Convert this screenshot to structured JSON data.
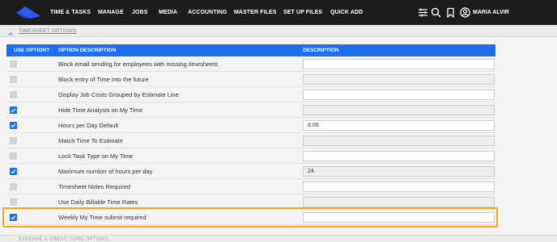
{
  "nav": {
    "items": [
      "TIME & TASKS",
      "MANAGE",
      "JOBS",
      "MEDIA",
      "ACCOUNTING",
      "MASTER FILES",
      "SET UP FILES",
      "QUICK ADD"
    ],
    "user_name": "MARIA ALVIR",
    "icons": [
      "sliders-icon",
      "search-icon",
      "bookmark-icon",
      "user-circle-icon"
    ]
  },
  "section": {
    "title": "TIMESHEET OPTIONS",
    "next_title": "EXPENSE & CREDIT CARD OPTIONS"
  },
  "table": {
    "headers": [
      "USE OPTION?",
      "OPTION DESCRIPTION",
      "DESCRIPTION"
    ],
    "rows": [
      {
        "checked": false,
        "label": "Block email sending for employees with missing timesheets",
        "value": "",
        "disabled": false
      },
      {
        "checked": false,
        "label": "Block entry of Time into the future",
        "value": "",
        "disabled": true
      },
      {
        "checked": false,
        "label": "Display Job Costs Grouped by Estimate Line",
        "value": "",
        "disabled": false
      },
      {
        "checked": true,
        "label": "Hide Time Analysis on My Time",
        "value": "",
        "disabled": true
      },
      {
        "checked": true,
        "label": "Hours per Day Default",
        "value": "8.00",
        "disabled": false
      },
      {
        "checked": false,
        "label": "Match Time To Estimate",
        "value": "",
        "disabled": true
      },
      {
        "checked": false,
        "label": "Lock Task Type on My Time",
        "value": "",
        "disabled": false
      },
      {
        "checked": true,
        "label": "Maximum number of hours per day",
        "value": "24",
        "disabled": true
      },
      {
        "checked": false,
        "label": "Timesheet Notes Required",
        "value": "",
        "disabled": false
      },
      {
        "checked": false,
        "label": "Use Daily Billable Time Rates",
        "value": "",
        "disabled": true
      },
      {
        "checked": true,
        "label": "Weekly My Time submit required",
        "value": "",
        "disabled": false
      }
    ]
  },
  "colors": {
    "topbar": "#1c1c1c",
    "accent": "#1b6ff0",
    "highlight": "#f6a81c",
    "logo": "#2f5bea"
  }
}
